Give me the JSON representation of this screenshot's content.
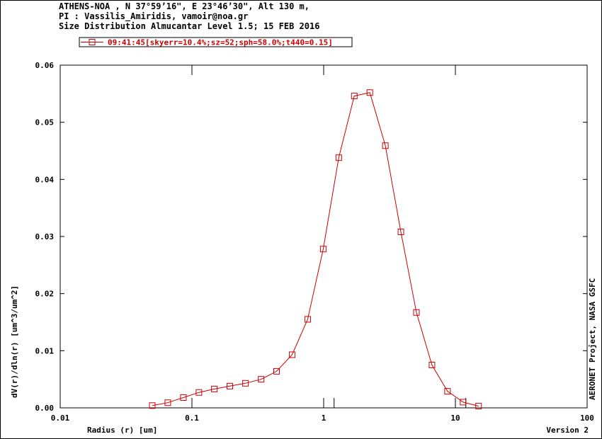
{
  "header": {
    "line1": "ATHENS-NOA , N 37°59’16\", E 23°46’30\", Alt 130 m,",
    "line2": "PI : Vassilis_Amiridis, vamoir@noa.gr",
    "line3": "Size Distribution Almucantar Level 1.5; 15 FEB 2016"
  },
  "footer": {
    "credit": "AERONET Project, NASA GSFC",
    "version": "Version 2"
  },
  "colors": {
    "series": "#cc0000",
    "axis": "#000000"
  },
  "chart_data": {
    "type": "line",
    "xscale": "log",
    "xlim": [
      0.01,
      100
    ],
    "ylim": [
      0,
      0.06
    ],
    "grid": false,
    "legend": "top-left",
    "xlabel": "Radius (r) [um]",
    "ylabel": "dV(r)/dln(r) [um^3/um^2]",
    "xticks": [
      {
        "value": 0.01,
        "label": "0.01"
      },
      {
        "value": 0.1,
        "label": "0.1"
      },
      {
        "value": 1,
        "label": "1"
      },
      {
        "value": 10,
        "label": "10"
      },
      {
        "value": 100,
        "label": "100"
      }
    ],
    "yticks": [
      {
        "value": 0,
        "label": "0.00"
      },
      {
        "value": 0.01,
        "label": "0.01"
      },
      {
        "value": 0.02,
        "label": "0.02"
      },
      {
        "value": 0.03,
        "label": "0.03"
      },
      {
        "value": 0.04,
        "label": "0.04"
      },
      {
        "value": 0.05,
        "label": "0.05"
      },
      {
        "value": 0.06,
        "label": "0.06"
      }
    ],
    "series": [
      {
        "name": "09:41:45[skyerr=10.4%;sz=52;sph=58.0%;t440=0.15]",
        "x": [
          0.05,
          0.0656,
          0.0861,
          0.113,
          0.148,
          0.194,
          0.255,
          0.335,
          0.439,
          0.576,
          0.756,
          0.992,
          1.302,
          1.708,
          2.241,
          2.94,
          3.857,
          5.06,
          6.641,
          8.713,
          11.432,
          15.0
        ],
        "y": [
          0.0004,
          0.0009,
          0.0018,
          0.0027,
          0.0033,
          0.0038,
          0.0043,
          0.005,
          0.0064,
          0.0093,
          0.0155,
          0.0278,
          0.0438,
          0.0546,
          0.0552,
          0.0459,
          0.0308,
          0.0167,
          0.0075,
          0.0029,
          0.001,
          0.0003
        ]
      }
    ]
  }
}
